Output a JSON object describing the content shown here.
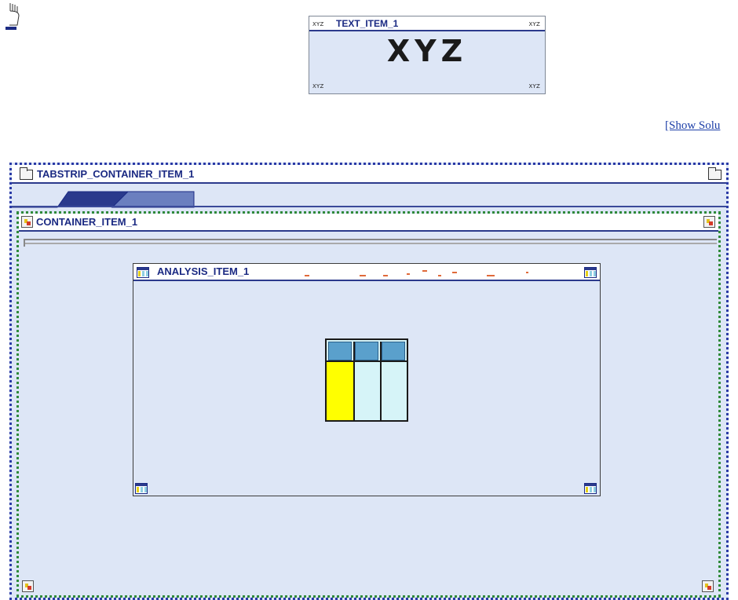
{
  "cursor": {
    "icon": "hand-cursor-icon"
  },
  "text_item": {
    "title": "TEXT_ITEM_1",
    "corner_tl": "XYZ",
    "corner_tr": "XYZ",
    "corner_bl": "XYZ",
    "corner_br": "XYZ",
    "display_text": "XYZ"
  },
  "show_solution": {
    "label": "[Show Solu"
  },
  "tabstrip": {
    "title": "TABSTRIP_CONTAINER_ITEM_1",
    "tabs": [
      "",
      ""
    ]
  },
  "container": {
    "title": "CONTAINER_ITEM_1"
  },
  "analysis": {
    "title": "ANALYSIS_ITEM_1"
  },
  "colors": {
    "title_text": "#1b2a83",
    "panel_bg": "#dde6f6",
    "tabstrip_border": "#2a3aa6",
    "container_border": "#2f8a3a",
    "table_highlight": "#ffff00"
  }
}
